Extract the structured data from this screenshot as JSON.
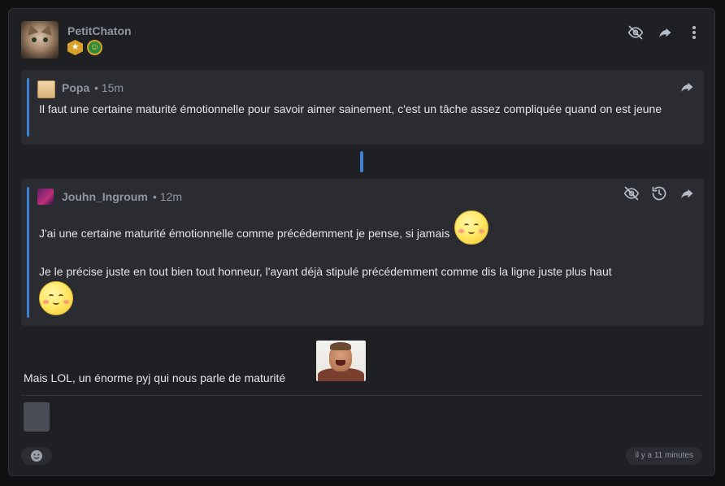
{
  "post": {
    "author": "PetitChaton",
    "badges": [
      "gold-star-badge",
      "green-elf-badge"
    ],
    "actions": [
      "hide-icon",
      "share-icon",
      "more-vertical-icon"
    ]
  },
  "quote1": {
    "author": "Popa",
    "time": "• 15m",
    "text": "Il faut une certaine maturité émotionnelle pour savoir aimer sainement, c'est un tâche assez compliquée quand on est jeune"
  },
  "quote2": {
    "author": "Jouhn_Ingroum",
    "time": "• 12m",
    "line1": "J'ai une certaine maturité émotionnelle comme précédemment je pense, si jamais",
    "line2": "Je le précise juste en tout bien tout honneur, l'ayant déjà stipulé précédemment comme dis la ligne juste plus haut"
  },
  "message": {
    "text": "Mais LOL, un énorme pyj qui nous parle de maturité"
  },
  "footer": {
    "timestamp": "il y a 11 minutes"
  },
  "colors": {
    "accent": "#3b82d6",
    "card_bg": "#1f2024",
    "quote_bg": "#2a2c32"
  }
}
